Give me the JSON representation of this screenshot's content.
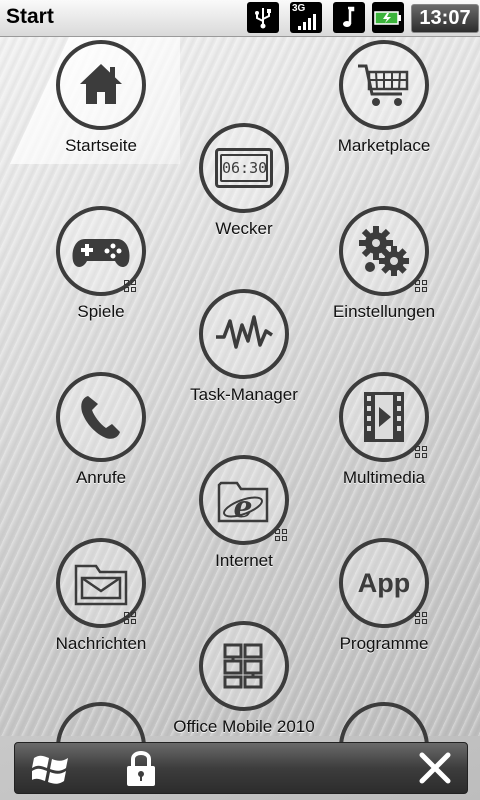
{
  "statusbar": {
    "title": "Start",
    "network": "3G",
    "time": "13:07",
    "icons": [
      "usb-icon",
      "signal-3g-icon",
      "music-note-icon",
      "battery-charging-icon"
    ]
  },
  "tiles": [
    {
      "label": "Startseite",
      "icon": "home-icon"
    },
    {
      "label": "Marketplace",
      "icon": "shopping-cart-icon"
    },
    {
      "label": "Wecker",
      "icon": "alarm-clock-icon",
      "display": "06:30"
    },
    {
      "label": "Spiele",
      "icon": "gamepad-icon"
    },
    {
      "label": "Einstellungen",
      "icon": "gears-icon"
    },
    {
      "label": "Task-Manager",
      "icon": "activity-wave-icon"
    },
    {
      "label": "Anrufe",
      "icon": "phone-icon"
    },
    {
      "label": "Multimedia",
      "icon": "film-play-icon"
    },
    {
      "label": "Internet",
      "icon": "internet-explorer-icon"
    },
    {
      "label": "Nachrichten",
      "icon": "mail-folder-icon"
    },
    {
      "label": "Programme",
      "icon": "app-icon",
      "text": "App"
    },
    {
      "label": "Office Mobile 2010",
      "icon": "office-icon"
    }
  ],
  "bottombar": {
    "icons": [
      "windows-start-icon",
      "lock-icon",
      "close-icon"
    ]
  },
  "colors": {
    "ring": "#3c3c3c",
    "background": "#dcdcdc",
    "bar": "#3d3d3d"
  }
}
